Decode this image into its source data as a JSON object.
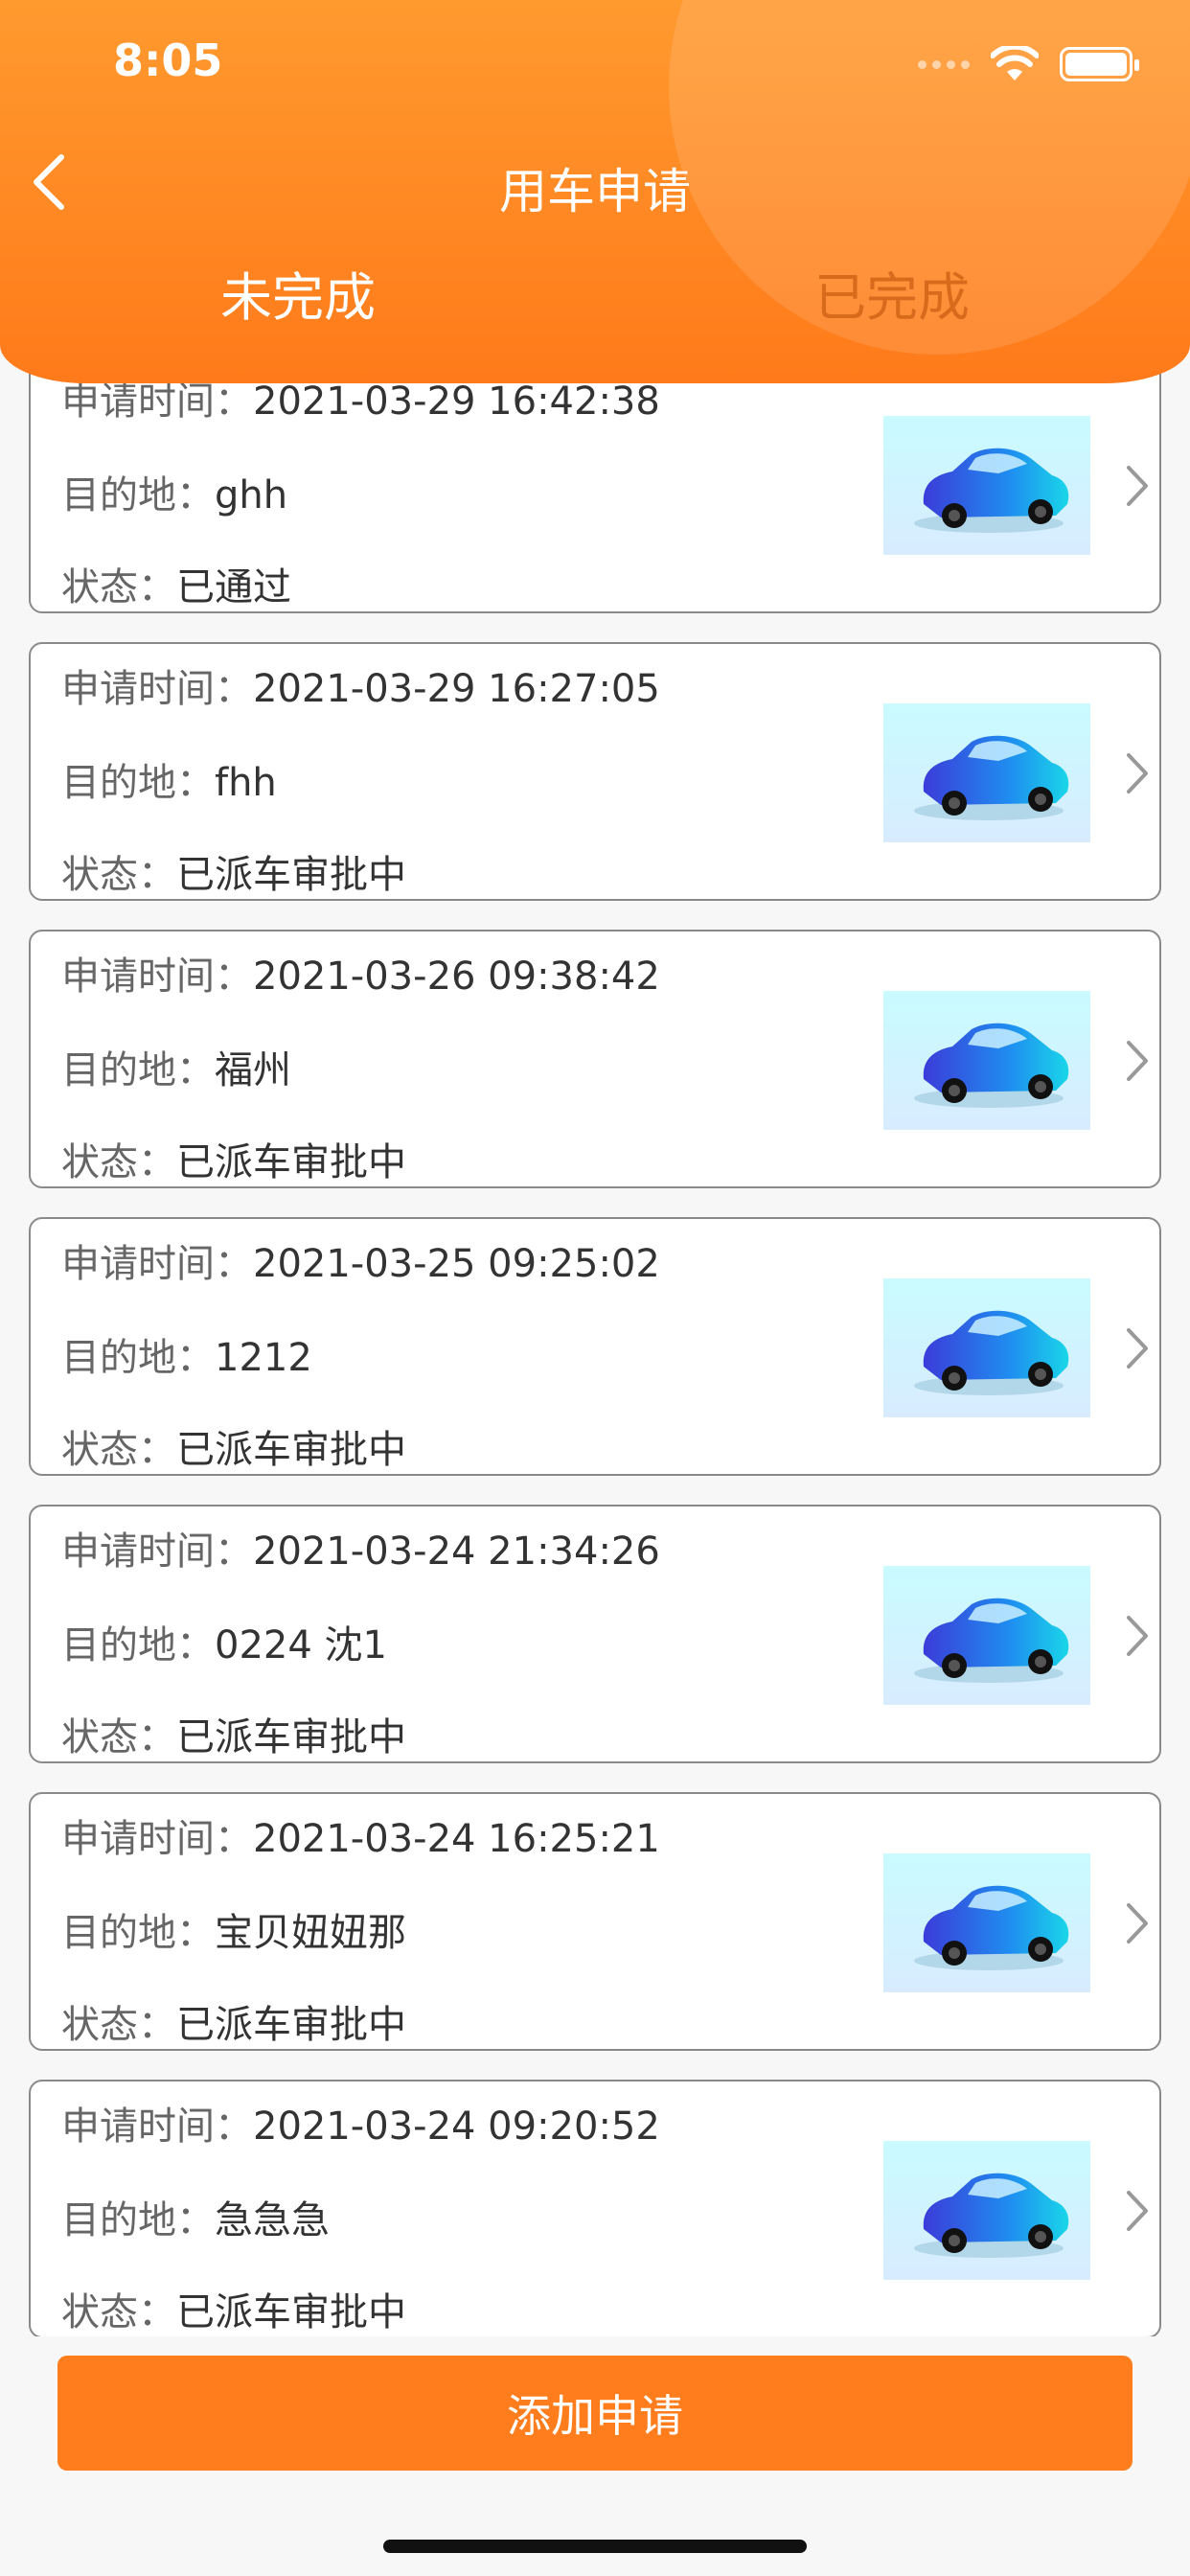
{
  "status_bar": {
    "time": "8:05"
  },
  "header": {
    "title": "用车申请",
    "tabs": [
      {
        "label": "未完成",
        "active": true
      },
      {
        "label": "已完成",
        "active": false
      }
    ]
  },
  "labels": {
    "time": "申请时间：",
    "dest": "目的地：",
    "status": "状态："
  },
  "records": [
    {
      "time": "2021-03-29 16:42:38",
      "dest": "ghh",
      "status": "已通过"
    },
    {
      "time": "2021-03-29 16:27:05",
      "dest": "fhh",
      "status": "已派车审批中"
    },
    {
      "time": "2021-03-26 09:38:42",
      "dest": "福州",
      "status": "已派车审批中"
    },
    {
      "time": "2021-03-25 09:25:02",
      "dest": "1212",
      "status": "已派车审批中"
    },
    {
      "time": "2021-03-24 21:34:26",
      "dest": "0224 沈1",
      "status": "已派车审批中"
    },
    {
      "time": "2021-03-24 16:25:21",
      "dest": "宝贝妞妞那",
      "status": "已派车审批中"
    },
    {
      "time": "2021-03-24 09:20:52",
      "dest": "急急急",
      "status": "已派车审批中"
    }
  ],
  "footer": {
    "add_label": "添加申请"
  },
  "colors": {
    "accent": "#ff7d1c",
    "header_top": "#ff9a2f"
  }
}
